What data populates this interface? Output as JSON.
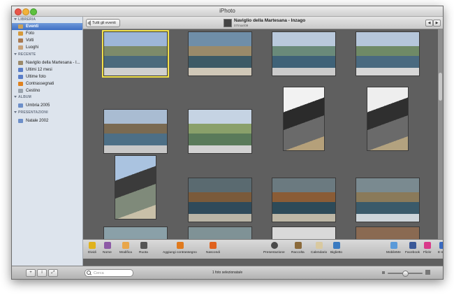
{
  "window": {
    "title": "iPhoto"
  },
  "sidebar": {
    "sections": [
      {
        "label": "LIBRERIA",
        "items": [
          {
            "label": "Eventi",
            "icon": "events-icon",
            "color": "#c9a15a",
            "selected": true
          },
          {
            "label": "Foto",
            "icon": "photos-icon",
            "color": "#d69a3a"
          },
          {
            "label": "Volti",
            "icon": "faces-icon",
            "color": "#a97a52"
          },
          {
            "label": "Luoghi",
            "icon": "places-icon",
            "color": "#c7a27a"
          }
        ]
      },
      {
        "label": "RECENTE",
        "items": [
          {
            "label": "Naviglio della Martesana - I...",
            "icon": "event-icon",
            "color": "#9c8a6a"
          },
          {
            "label": "Ultimi 12 mesi",
            "icon": "calendar-icon",
            "color": "#5a7ec8"
          },
          {
            "label": "Ultime foto",
            "icon": "photo-stack-icon",
            "color": "#5a7ec8"
          },
          {
            "label": "Contrassegnati",
            "icon": "flag-icon",
            "color": "#e0821e"
          },
          {
            "label": "Cestino",
            "icon": "trash-icon",
            "color": "#9aa3ad"
          }
        ]
      },
      {
        "label": "ALBUM",
        "items": [
          {
            "label": "Umbria 2005",
            "icon": "album-icon",
            "color": "#6d8fc9"
          }
        ]
      },
      {
        "label": "PRESENTAZIONI",
        "items": [
          {
            "label": "Natale 2002",
            "icon": "slideshow-icon",
            "color": "#6d8fc9"
          }
        ]
      }
    ]
  },
  "top_bar": {
    "back_label": "Tutti gli eventi",
    "event_title": "Naviglio della Martesana - Inzago",
    "event_date": "07/mar/09",
    "prev_icon": "arrow-left-icon",
    "next_icon": "arrow-right-icon"
  },
  "toolbar": {
    "left": [
      {
        "label": "Dividi",
        "icon": "split-icon",
        "color": "#e0b21c"
      },
      {
        "label": "Nome",
        "icon": "name-icon",
        "color": "#8d5aa6"
      },
      {
        "label": "Modifica",
        "icon": "edit-pencil-icon",
        "color": "#e8a64a"
      },
      {
        "label": "Ruota",
        "icon": "rotate-icon",
        "color": "#555555"
      },
      {
        "label": "Aggiungi contrassegno",
        "icon": "flag-icon",
        "color": "#e07a1e"
      },
      {
        "label": "Nascondi",
        "icon": "hide-x-icon",
        "color": "#e0621e"
      }
    ],
    "center": [
      {
        "label": "Presentazione",
        "icon": "play-icon",
        "color": "#4a4a4a"
      },
      {
        "label": "Raccolta",
        "icon": "album-book-icon",
        "color": "#8b6a3a"
      },
      {
        "label": "Calendario",
        "icon": "calendar-icon",
        "color": "#d9c9a0"
      },
      {
        "label": "Biglietto",
        "icon": "card-icon",
        "color": "#3a7ac0"
      }
    ],
    "right": [
      {
        "label": "MobileMe",
        "icon": "mobileme-cloud-icon",
        "color": "#5a9ad9"
      },
      {
        "label": "Facebook",
        "icon": "facebook-icon",
        "color": "#3b5998"
      },
      {
        "label": "Flickr",
        "icon": "flickr-icon",
        "color": "#d93a8a"
      },
      {
        "label": "E-mail",
        "icon": "email-stamp-icon",
        "color": "#3a6ac0"
      }
    ]
  },
  "statusbar": {
    "search_placeholder": "Cerca",
    "status": "1 foto selezionata/e",
    "zoom_level": 0.5
  },
  "photos": [
    {
      "name": "photo-1",
      "palette": [
        "#9db6d8",
        "#7d8b6a",
        "#4b6a7c",
        "#cfcfcf"
      ],
      "selected": true
    },
    {
      "name": "photo-2",
      "palette": [
        "#6f8ea8",
        "#9a8a6a",
        "#3d5a66",
        "#d0c8b8"
      ]
    },
    {
      "name": "photo-3",
      "palette": [
        "#b9c9dc",
        "#6a8a7a",
        "#3f6278",
        "#cbcbcb"
      ]
    },
    {
      "name": "photo-4",
      "palette": [
        "#b5c6da",
        "#6f8a66",
        "#4a6a80",
        "#d7d7d7"
      ]
    },
    {
      "name": "photo-5",
      "palette": [
        "#a9bcd2",
        "#7a6a52",
        "#4d6f86",
        "#c8c8c8"
      ]
    },
    {
      "name": "photo-6",
      "palette": [
        "#c5d3e3",
        "#8aa06a",
        "#5a7a5a",
        "#d2d2d2"
      ]
    },
    {
      "name": "photo-7",
      "palette": [
        "#f2f2f2",
        "#2b2b2b",
        "#6a6a6a",
        "#b5a07a"
      ]
    },
    {
      "name": "photo-8",
      "palette": [
        "#eeeeee",
        "#2f2f2f",
        "#6a6a6a",
        "#b3a27f"
      ]
    },
    {
      "name": "photo-9",
      "palette": [
        "#aac3e0",
        "#3b3b3b",
        "#7f8a7a",
        "#c9c0a8"
      ]
    },
    {
      "name": "photo-10",
      "palette": [
        "#5a6a70",
        "#7a5a3a",
        "#2f4a5a",
        "#b9b4a6"
      ]
    },
    {
      "name": "photo-11",
      "palette": [
        "#6b7a80",
        "#8a5c36",
        "#2d4a58",
        "#bdb7a6"
      ]
    },
    {
      "name": "photo-12",
      "palette": [
        "#7a8a90",
        "#8a7a5a",
        "#3a5a6a",
        "#cdd5da"
      ]
    },
    {
      "name": "photo-13",
      "palette": [
        "#8aa0a8",
        "#5a6a5a",
        "#4f7f88",
        "#d8d8d8"
      ]
    },
    {
      "name": "photo-14",
      "palette": [
        "#7f9296",
        "#7a6a4a",
        "#4a6f7a",
        "#c6c6c6"
      ]
    },
    {
      "name": "photo-15",
      "palette": [
        "#d9d9d9",
        "#8a4a2a",
        "#4f6f7a",
        "#b8a68a"
      ]
    },
    {
      "name": "photo-16",
      "palette": [
        "#8a6a52",
        "#a0522d",
        "#5a4a3a",
        "#c2b29a"
      ]
    }
  ]
}
